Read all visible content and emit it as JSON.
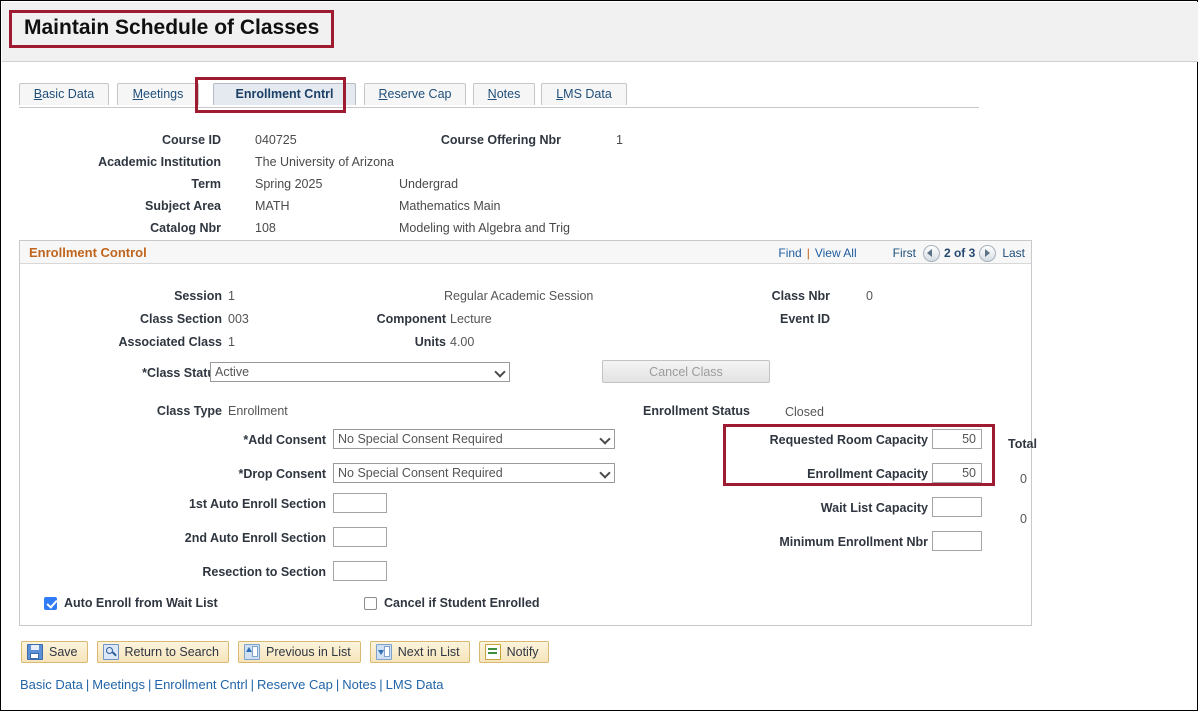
{
  "page": {
    "title": "Maintain Schedule of Classes"
  },
  "tabs": [
    {
      "label": "Basic Data",
      "accesskey": "B",
      "active": false
    },
    {
      "label": "Meetings",
      "accesskey": "M",
      "active": false
    },
    {
      "label": "Enrollment Cntrl",
      "accesskey": "",
      "active": true
    },
    {
      "label": "Reserve Cap",
      "accesskey": "R",
      "active": false
    },
    {
      "label": "Notes",
      "accesskey": "N",
      "active": false
    },
    {
      "label": "LMS Data",
      "accesskey": "L",
      "active": false
    }
  ],
  "course_header": {
    "course_id_label": "Course ID",
    "course_id_value": "040725",
    "course_offering_nbr_label": "Course Offering Nbr",
    "course_offering_nbr_value": "1",
    "academic_institution_label": "Academic Institution",
    "academic_institution_value": "The University of Arizona",
    "term_label": "Term",
    "term_value": "Spring 2025",
    "term_career": "Undergrad",
    "subject_area_label": "Subject Area",
    "subject_area_value": "MATH",
    "subject_area_descr": "Mathematics Main",
    "catalog_nbr_label": "Catalog Nbr",
    "catalog_nbr_value": "108",
    "catalog_descr": "Modeling with Algebra and Trig"
  },
  "group": {
    "title": "Enrollment Control",
    "nav": {
      "find": "Find",
      "view_all": "View All",
      "first": "First",
      "counter": "2 of 3",
      "last": "Last",
      "prev_icon": "left-arrow-icon",
      "next_icon": "right-arrow-icon"
    }
  },
  "class_info": {
    "session_label": "Session",
    "session_value": "1",
    "session_descr": "Regular Academic Session",
    "class_nbr_label": "Class Nbr",
    "class_nbr_value": "0",
    "class_section_label": "Class Section",
    "class_section_value": "003",
    "component_label": "Component",
    "component_value": "Lecture",
    "event_id_label": "Event ID",
    "event_id_value": "",
    "associated_class_label": "Associated Class",
    "associated_class_value": "1",
    "units_label": "Units",
    "units_value": "4.00",
    "class_status_label": "*Class Status",
    "class_status_value": "Active",
    "cancel_class_button": "Cancel Class",
    "class_type_label": "Class Type",
    "class_type_value": "Enrollment",
    "enrollment_status_label": "Enrollment Status",
    "enrollment_status_value": "Closed"
  },
  "consent": {
    "add_consent_label": "*Add Consent",
    "add_consent_value": "No Special Consent Required",
    "drop_consent_label": "*Drop Consent",
    "drop_consent_value": "No Special Consent Required",
    "auto_enroll_1_label": "1st Auto Enroll Section",
    "auto_enroll_1_value": "",
    "auto_enroll_2_label": "2nd Auto Enroll Section",
    "auto_enroll_2_value": "",
    "resection_label": "Resection to Section",
    "resection_value": ""
  },
  "capacity": {
    "total_label": "Total",
    "requested_room_capacity_label": "Requested Room Capacity",
    "requested_room_capacity_value": "50",
    "enrollment_capacity_label": "Enrollment Capacity",
    "enrollment_capacity_value": "50",
    "enrollment_total": "0",
    "wait_list_capacity_label": "Wait List Capacity",
    "wait_list_capacity_value": "",
    "wait_list_total": "0",
    "minimum_enrollment_label": "Minimum Enrollment Nbr",
    "minimum_enrollment_value": ""
  },
  "checkboxes": {
    "auto_enroll_wait_list_label": "Auto Enroll from Wait List",
    "auto_enroll_wait_list_checked": true,
    "cancel_if_student_enrolled_label": "Cancel if Student Enrolled",
    "cancel_if_student_enrolled_checked": false
  },
  "toolbar": [
    {
      "label": "Save",
      "icon": "save-floppy-icon"
    },
    {
      "label": "Return to Search",
      "icon": "search-icon"
    },
    {
      "label": "Previous in List",
      "icon": "previous-page-icon"
    },
    {
      "label": "Next in List",
      "icon": "next-page-icon"
    },
    {
      "label": "Notify",
      "icon": "notify-envelope-icon"
    }
  ],
  "bottom_links": [
    "Basic Data",
    "Meetings",
    "Enrollment Cntrl",
    "Reserve Cap",
    "Notes",
    "LMS Data"
  ],
  "colors": {
    "highlight": "#9e1b32",
    "group_title": "#c0651d",
    "link": "#2265a8",
    "checkbox_checked": "#2f7cf6"
  }
}
